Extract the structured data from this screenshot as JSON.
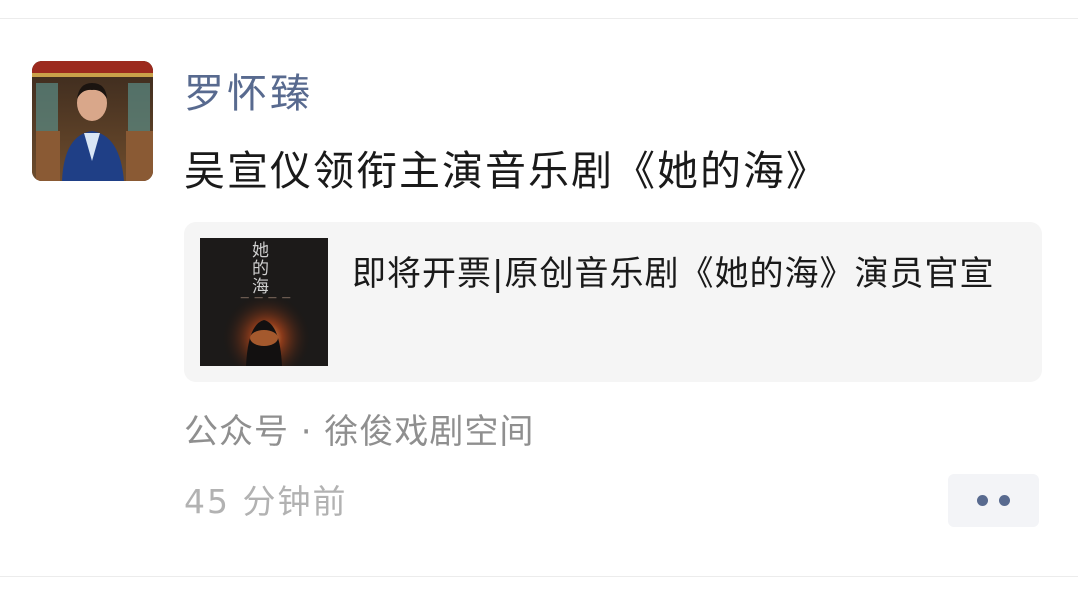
{
  "author": {
    "name": "罗怀臻"
  },
  "post": {
    "text": "吴宣仪领衔主演音乐剧《她的海》"
  },
  "link_card": {
    "title": "即将开票|原创音乐剧《她的海》演员官宣",
    "thumbnail_text": "她的海"
  },
  "source": {
    "text": "公众号 · 徐俊戏剧空间"
  },
  "time": {
    "text": "45 分钟前"
  },
  "colors": {
    "author_name": "#586a8f",
    "body_text": "#1a1a1a",
    "meta_text": "#8f8f8f",
    "time_text": "#b2b2b2",
    "card_bg": "#f5f5f5",
    "more_button_bg": "#f3f4f7"
  },
  "icons": {
    "more": "two-dots-more-icon"
  }
}
